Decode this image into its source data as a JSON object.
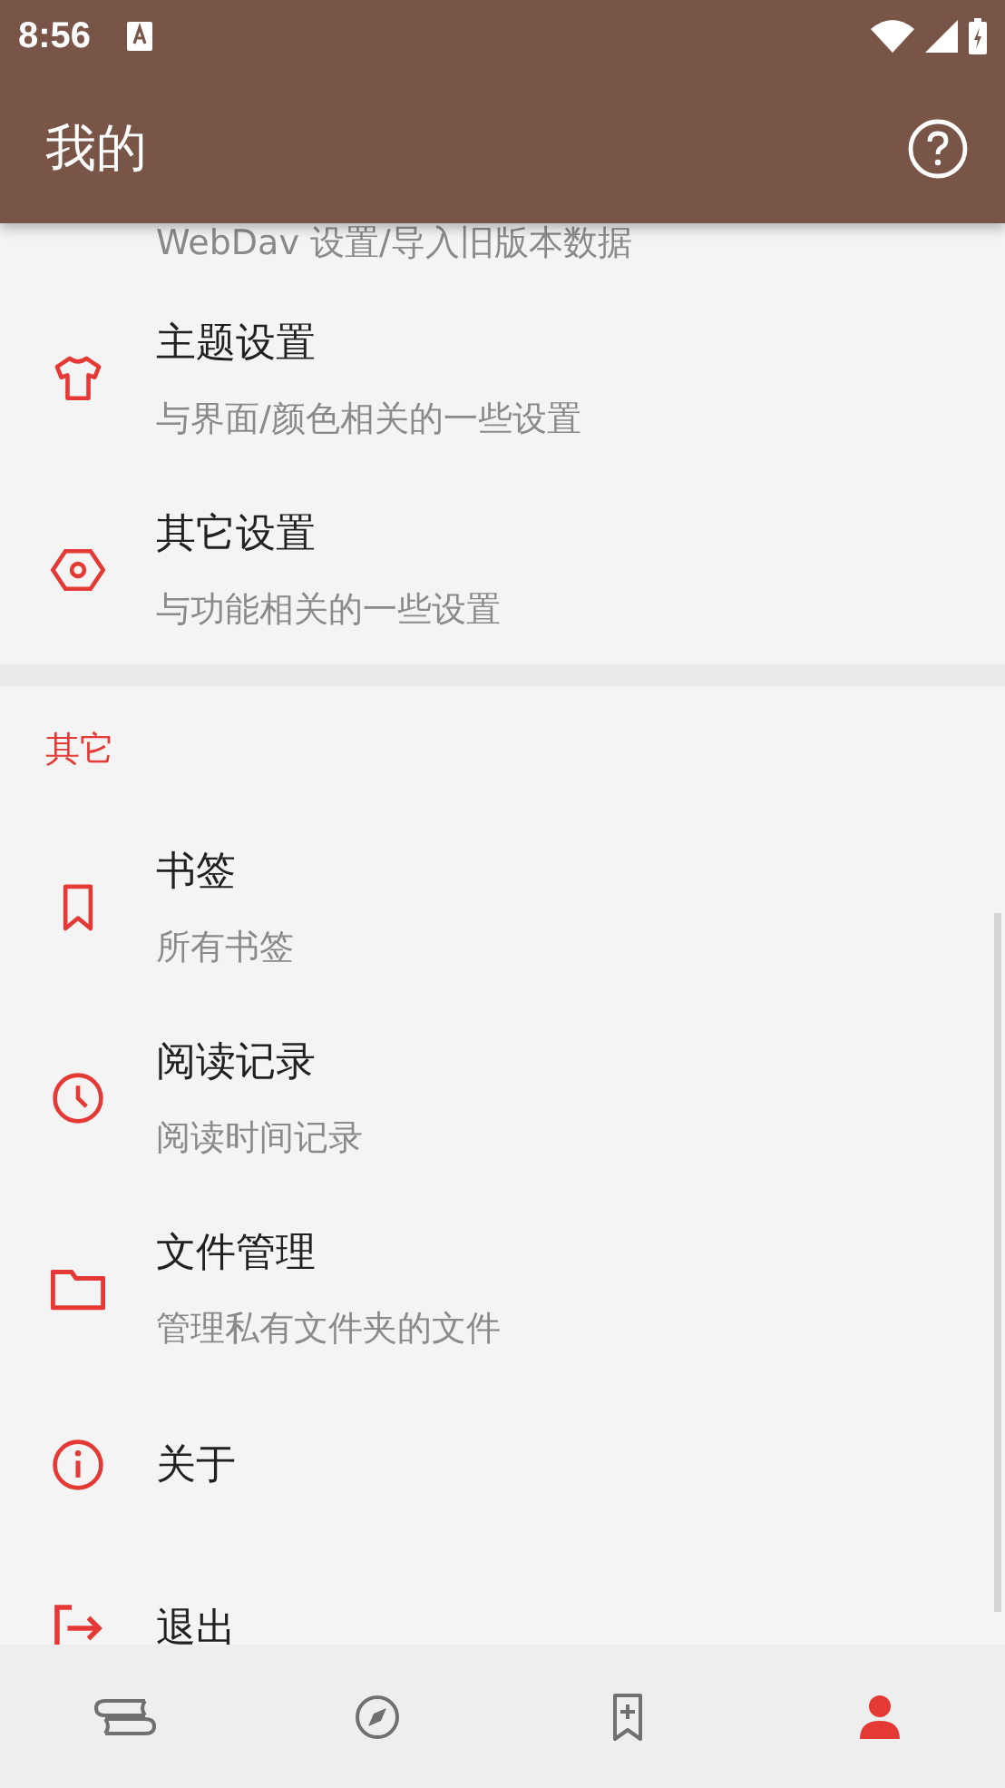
{
  "status_bar": {
    "time": "8:56"
  },
  "app_bar": {
    "title": "我的"
  },
  "sections": [
    {
      "items": [
        {
          "subtitle": "WebDav 设置/导入旧版本数据"
        },
        {
          "kind": "shirt",
          "title": "主题设置",
          "subtitle": "与界面/颜色相关的一些设置"
        },
        {
          "kind": "nut",
          "title": "其它设置",
          "subtitle": "与功能相关的一些设置"
        }
      ]
    },
    {
      "header": "其它",
      "items": [
        {
          "kind": "bookmark",
          "title": "书签",
          "subtitle": "所有书签"
        },
        {
          "kind": "clock",
          "title": "阅读记录",
          "subtitle": "阅读时间记录"
        },
        {
          "kind": "folder",
          "title": "文件管理",
          "subtitle": "管理私有文件夹的文件"
        },
        {
          "kind": "info",
          "title": "关于"
        },
        {
          "kind": "logout",
          "title": "退出"
        }
      ]
    }
  ],
  "bottom_nav": [
    {
      "kind": "books",
      "selected": false
    },
    {
      "kind": "compass",
      "selected": false
    },
    {
      "kind": "bookmark",
      "selected": false
    },
    {
      "kind": "person",
      "selected": true
    }
  ]
}
